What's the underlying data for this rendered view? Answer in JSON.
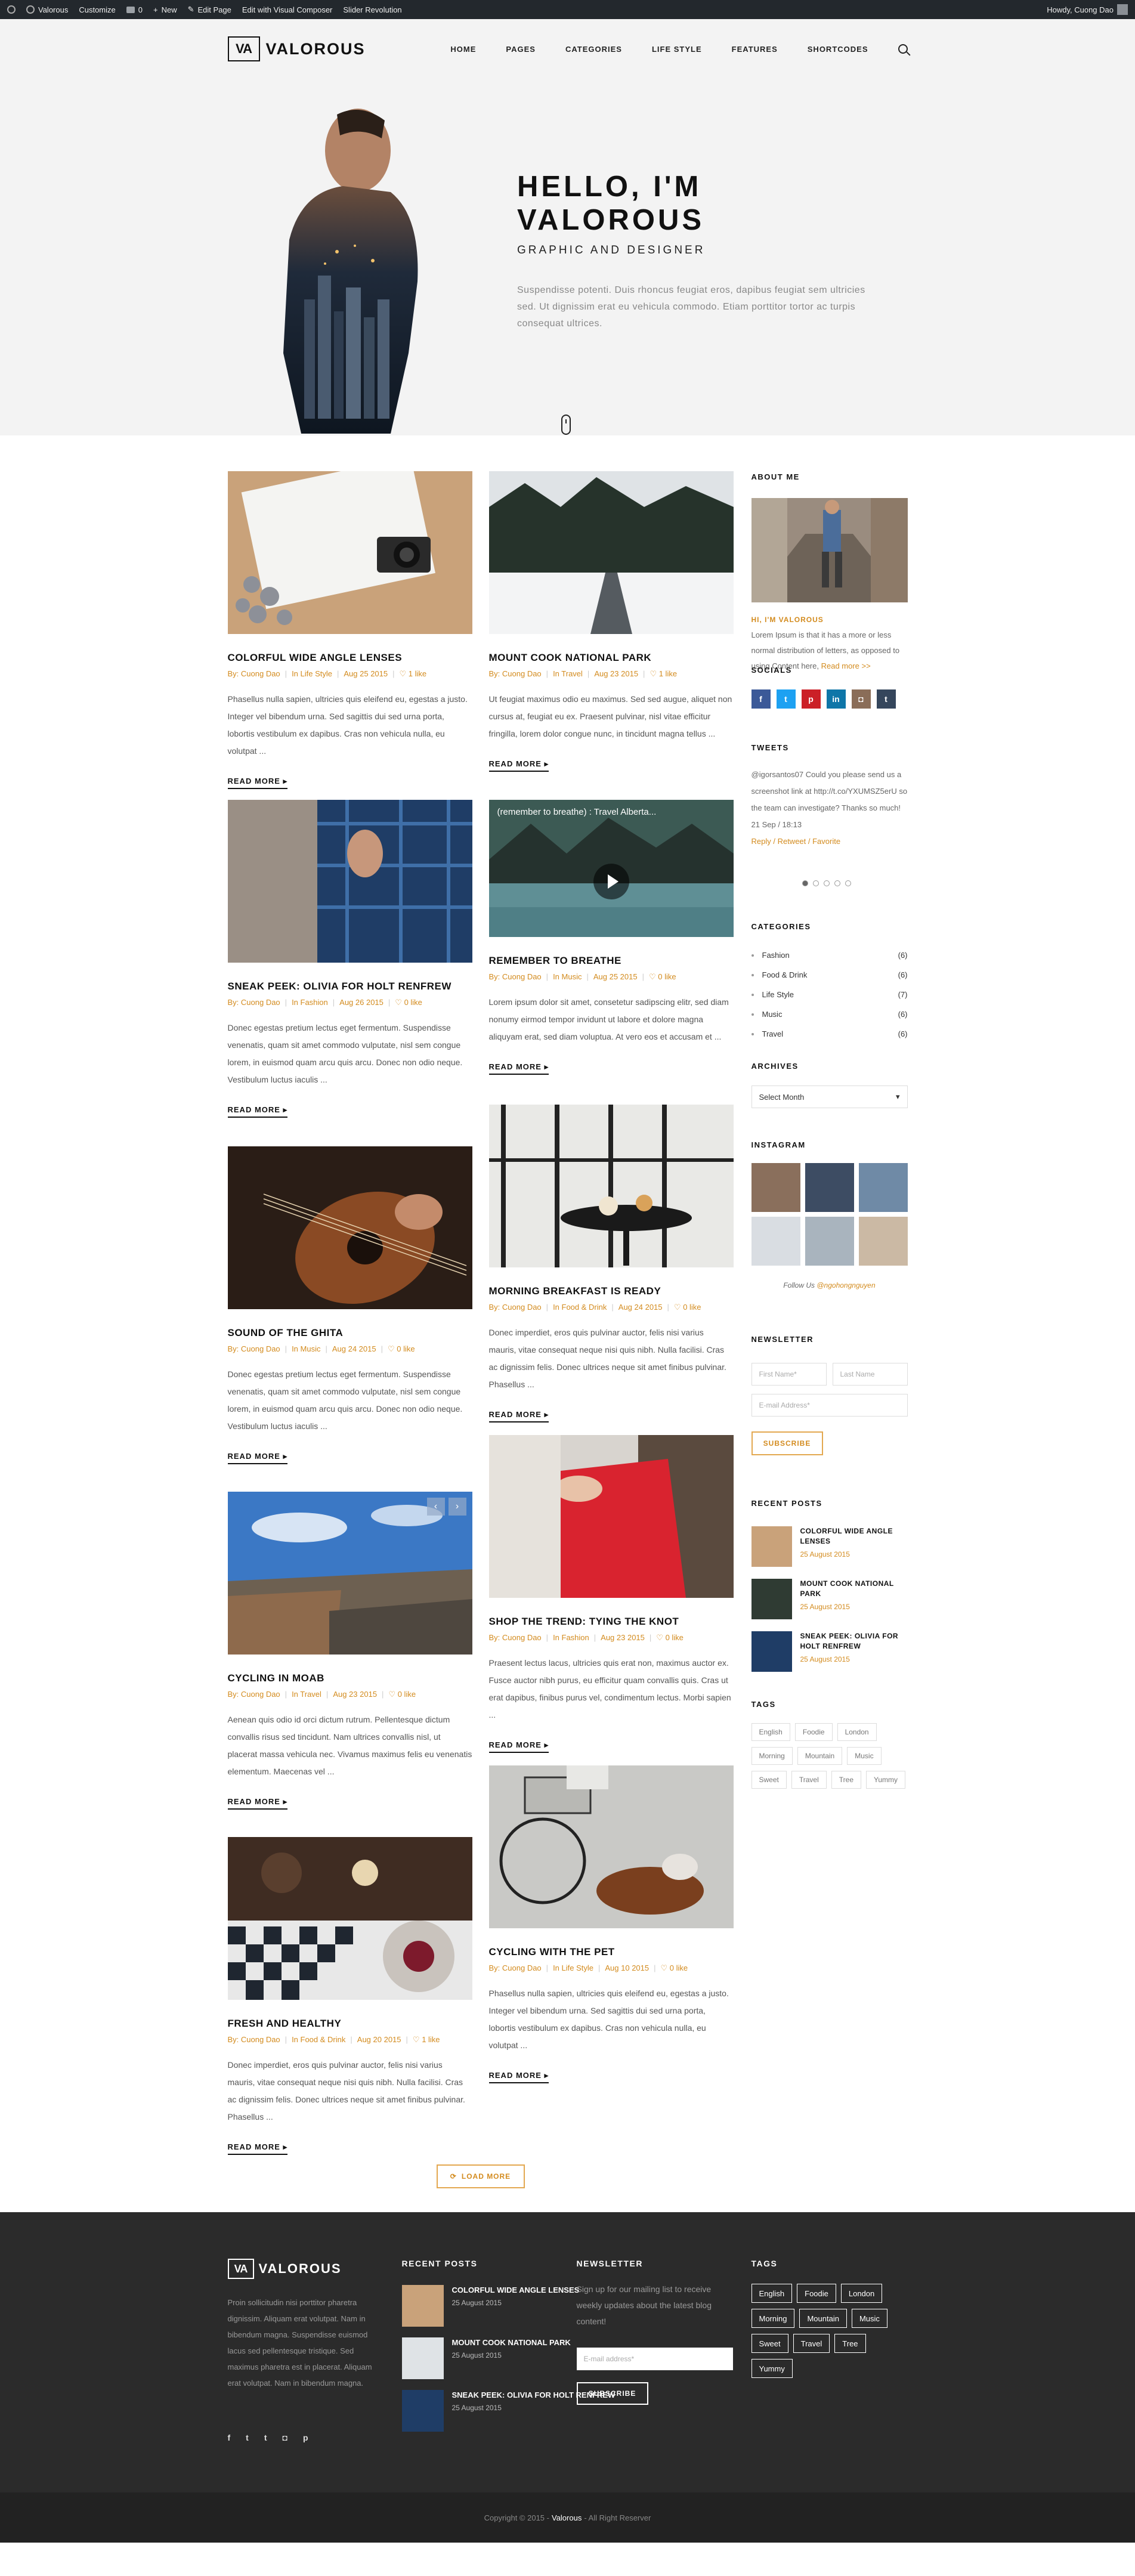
{
  "adminbar": {
    "site": "Valorous",
    "customize": "Customize",
    "comments": "0",
    "new": "New",
    "edit": "Edit Page",
    "composer": "Edit with Visual Composer",
    "slider": "Slider Revolution",
    "user": "Howdy, Cuong Dao"
  },
  "brand": {
    "mark": "VA",
    "name": "VALOROUS"
  },
  "nav": [
    "HOME",
    "PAGES",
    "CATEGORIES",
    "LIFE STYLE",
    "FEATURES",
    "SHORTCODES"
  ],
  "hero": {
    "title": "HELLO, I'M VALOROUS",
    "subtitle": "GRAPHIC AND DESIGNER",
    "desc": "Suspendisse potenti. Duis rhoncus feugiat eros, dapibus feugiat sem ultricies sed. Ut dignissim erat eu vehicula commodo. Etiam porttitor tortor ac turpis consequat ultrices."
  },
  "posts": [
    {
      "title": "COLORFUL WIDE ANGLE LENSES",
      "author": "By: Cuong Dao",
      "cat": "In Life Style",
      "date": "Aug 25 2015",
      "likes": "1 like",
      "excerpt": "Phasellus nulla sapien, ultricies quis eleifend eu, egestas a justo. Integer vel bibendum urna. Sed sagittis dui sed urna porta, lobortis vestibulum ex dapibus. Cras non vehicula nulla, eu volutpat ...",
      "more": "READ MORE"
    },
    {
      "title": "MOUNT COOK NATIONAL PARK",
      "author": "By: Cuong Dao",
      "cat": "In Travel",
      "date": "Aug 23 2015",
      "likes": "1 like",
      "excerpt": "Ut feugiat maximus odio eu maximus. Sed sed augue, aliquet non cursus at, feugiat eu ex. Praesent pulvinar, nisl vitae efficitur fringilla, lorem dolor congue nunc, in tincidunt magna tellus ...",
      "more": "READ MORE"
    },
    {
      "title": "SNEAK PEEK: OLIVIA FOR HOLT RENFREW",
      "author": "By: Cuong Dao",
      "cat": "In Fashion",
      "date": "Aug 26 2015",
      "likes": "0 like",
      "excerpt": "Donec egestas pretium lectus eget fermentum. Suspendisse venenatis, quam sit amet commodo vulputate, nisl sem congue lorem, in euismod quam arcu quis arcu. Donec non odio neque. Vestibulum luctus iaculis ...",
      "more": "READ MORE"
    },
    {
      "title": "REMEMBER TO BREATHE",
      "author": "By: Cuong Dao",
      "cat": "In Music",
      "date": "Aug 25 2015",
      "likes": "0 like",
      "excerpt": "Lorem ipsum dolor sit amet, consetetur sadipscing elitr, sed diam nonumy eirmod tempor invidunt ut labore et dolore magna aliquyam erat, sed diam voluptua. At vero eos et accusam et ...",
      "more": "READ MORE",
      "video": "(remember to breathe) : Travel Alberta..."
    },
    {
      "title": "SOUND OF THE GHITA",
      "author": "By: Cuong Dao",
      "cat": "In Music",
      "date": "Aug 24 2015",
      "likes": "0 like",
      "excerpt": "Donec egestas pretium lectus eget fermentum. Suspendisse venenatis, quam sit amet commodo vulputate, nisl sem congue lorem, in euismod quam arcu quis arcu. Donec non odio neque. Vestibulum luctus iaculis ...",
      "more": "READ MORE"
    },
    {
      "title": "MORNING BREAKFAST IS READY",
      "author": "By: Cuong Dao",
      "cat": "In Food & Drink",
      "date": "Aug 24 2015",
      "likes": "0 like",
      "excerpt": "Donec imperdiet, eros quis pulvinar auctor, felis nisi varius mauris, vitae consequat neque nisi quis nibh. Nulla facilisi. Cras ac dignissim felis. Donec ultrices neque sit amet finibus pulvinar. Phasellus ...",
      "more": "READ MORE"
    },
    {
      "title": "CYCLING IN MOAB",
      "author": "By: Cuong Dao",
      "cat": "In Travel",
      "date": "Aug 23 2015",
      "likes": "0 like",
      "excerpt": "Aenean quis odio id orci dictum rutrum. Pellentesque dictum convallis risus sed tincidunt. Nam ultrices convallis nisl, ut placerat massa vehicula nec. Vivamus maximus felis eu venenatis elementum. Maecenas vel ...",
      "more": "READ MORE"
    },
    {
      "title": "SHOP THE TREND: TYING THE KNOT",
      "author": "By: Cuong Dao",
      "cat": "In Fashion",
      "date": "Aug 23 2015",
      "likes": "0 like",
      "excerpt": "Praesent lectus lacus, ultricies quis erat non, maximus auctor ex. Fusce auctor nibh purus, eu efficitur quam convallis quis. Cras ut erat dapibus, finibus purus vel, condimentum lectus. Morbi sapien ...",
      "more": "READ MORE"
    },
    {
      "title": "FRESH AND HEALTHY",
      "author": "By: Cuong Dao",
      "cat": "In Food & Drink",
      "date": "Aug 20 2015",
      "likes": "1 like",
      "excerpt": "Donec imperdiet, eros quis pulvinar auctor, felis nisi varius mauris, vitae consequat neque nisi quis nibh. Nulla facilisi. Cras ac dignissim felis. Donec ultrices neque sit amet finibus pulvinar. Phasellus ...",
      "more": "READ MORE"
    },
    {
      "title": "CYCLING WITH THE PET",
      "author": "By: Cuong Dao",
      "cat": "In Life Style",
      "date": "Aug 10 2015",
      "likes": "0 like",
      "excerpt": "Phasellus nulla sapien, ultricies quis eleifend eu, egestas a justo. Integer vel bibendum urna. Sed sagittis dui sed urna porta, lobortis vestibulum ex dapibus. Cras non vehicula nulla, eu volutpat ...",
      "more": "READ MORE"
    }
  ],
  "load_more": "LOAD MORE",
  "sidebar": {
    "about_title": "ABOUT ME",
    "about_name": "HI, I'M VALOROUS",
    "about_text": "Lorem Ipsum is that it has a more or less normal distribution of letters, as opposed to using Content here,",
    "about_link": "Read more >>",
    "socials_title": "SOCIALS",
    "socials": [
      "f",
      "t",
      "p",
      "in",
      "◘",
      "t"
    ],
    "tweets_title": "TWEETS",
    "tweet": "@igorsantos07 Could you please send us a screenshot link at http://t.co/YXUMSZ5erU so the team can investigate? Thanks so much!",
    "tweet_date": "21 Sep / 18:13",
    "tweet_actions": "Reply / Retweet / Favorite",
    "categories_title": "CATEGORIES",
    "categories": [
      {
        "name": "Fashion",
        "count": "(6)"
      },
      {
        "name": "Food & Drink",
        "count": "(6)"
      },
      {
        "name": "Life Style",
        "count": "(7)"
      },
      {
        "name": "Music",
        "count": "(6)"
      },
      {
        "name": "Travel",
        "count": "(6)"
      }
    ],
    "archives_title": "ARCHIVES",
    "archive_select": "Select Month",
    "instagram_title": "INSTAGRAM",
    "follow_prefix": "Follow Us",
    "follow_handle": "@ngohongnguyen",
    "newsletter_title": "NEWSLETTER",
    "first_name": "First Name*",
    "last_name": "Last Name",
    "email": "E-mail Address*",
    "subscribe": "SUBSCRIBE",
    "recent_title": "RECENT POSTS",
    "recent": [
      {
        "title": "COLORFUL WIDE ANGLE LENSES",
        "date": "25 August 2015"
      },
      {
        "title": "MOUNT COOK NATIONAL PARK",
        "date": "25 August 2015"
      },
      {
        "title": "SNEAK PEEK: OLIVIA FOR HOLT RENFREW",
        "date": "25 August 2015"
      }
    ],
    "tags_title": "TAGS",
    "tags": [
      "English",
      "Foodie",
      "London",
      "Morning",
      "Mountain",
      "Music",
      "Sweet",
      "Travel",
      "Tree",
      "Yummy"
    ]
  },
  "footer": {
    "about": "Proin sollicitudin nisi porttitor pharetra dignissim. Aliquam erat volutpat. Nam in bibendum magna. Suspendisse euismod lacus sed pellentesque tristique. Sed maximus pharetra est in placerat. Aliquam erat volutpat. Nam in bibendum magna.",
    "socials": [
      "f",
      "t",
      "t",
      "◘",
      "p"
    ],
    "recent_title": "RECENT POSTS",
    "recent": [
      {
        "title": "COLORFUL WIDE ANGLE LENSES",
        "date": "25 August 2015"
      },
      {
        "title": "MOUNT COOK NATIONAL PARK",
        "date": "25 August 2015"
      },
      {
        "title": "SNEAK PEEK: OLIVIA FOR HOLT RENFREW",
        "date": "25 August 2015"
      }
    ],
    "newsletter_title": "NEWSLETTER",
    "newsletter_text": "Sign up for our mailing list to receive weekly updates about the latest blog content!",
    "email": "E-mail address*",
    "subscribe": "SUBSCRIBE",
    "tags_title": "TAGS",
    "tags": [
      "English",
      "Foodie",
      "London",
      "Morning",
      "Mountain",
      "Music",
      "Sweet",
      "Travel",
      "Tree",
      "Yummy"
    ],
    "copy_pre": "Copyright © 2015 -",
    "copy_brand": "Valorous",
    "copy_post": "- All Right Reserver"
  },
  "colors": {
    "accent": "#d38b1e",
    "dark": "#2b2b2b",
    "facebook": "#3b5998",
    "twitter": "#1da1f2",
    "pinterest": "#cb2027",
    "linkedin": "#0e76a8",
    "instagram": "#8a6d58",
    "tumblr": "#35465c"
  }
}
